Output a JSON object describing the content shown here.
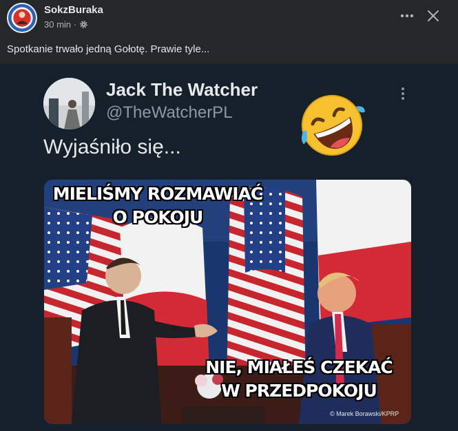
{
  "post": {
    "author": "SokzBuraka",
    "time": "30 min",
    "caption": "Spotkanie trwało jedną Gołotę. Prawie tyle..."
  },
  "tweet": {
    "name": "Jack The Watcher",
    "handle": "@TheWatcherPL",
    "text": "Wyjaśniło się...",
    "meme_top_line1": "MIELIŚMY ROZMAWIAĆ",
    "meme_top_line2": "O POKOJU",
    "meme_bottom_line1": "NIE, MIAŁEŚ CZEKAĆ",
    "meme_bottom_line2": "W PRZEDPOKOJU",
    "photo_credit": "© Marek Borawski/KPRP"
  },
  "icons": {
    "privacy": "gear-icon",
    "more": "more-horizontal-icon",
    "close": "close-icon",
    "tweet_more": "more-vertical-icon",
    "emoji": "rolling-on-floor-laughing-emoji"
  },
  "colors": {
    "background": "#252728",
    "tweet_background": "#15202b",
    "text_primary": "#e4e6eb",
    "text_secondary": "#b0b3b8"
  }
}
